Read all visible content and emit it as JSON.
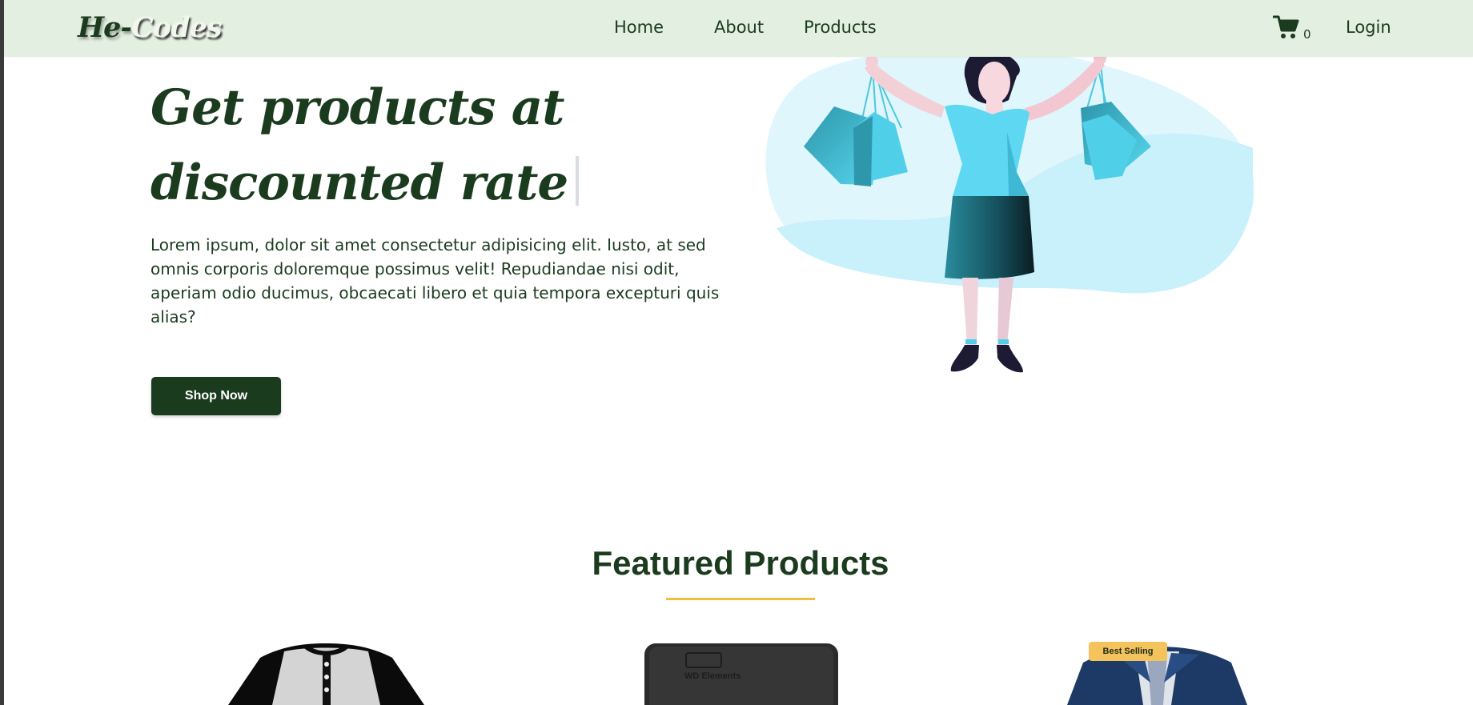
{
  "nav": {
    "logo_part1": "He-",
    "logo_part2": "Codes",
    "links": [
      "Home",
      "About",
      "Products"
    ],
    "cart_count": "0",
    "login": "Login"
  },
  "hero": {
    "title": "Get products at discounted rate",
    "text": "Lorem ipsum, dolor sit amet consectetur adipisicing elit. Iusto, at sed omnis corporis doloremque possimus velit! Repudiandae nisi odit, aperiam odio ducimus, obcaecati libero et quia tempora excepturi quis alias?",
    "button": "Shop Now"
  },
  "featured": {
    "title": "Featured Products",
    "products": [
      {
        "name": "henley-shirt"
      },
      {
        "name": "wd-elements-drive",
        "printed_label": "WD Elements"
      },
      {
        "name": "denim-jacket",
        "badge": "Best Selling"
      }
    ]
  },
  "colors": {
    "brand": "#1b3b1e",
    "navbar_bg": "#e3efe0",
    "accent": "#f0bd43",
    "illustration_blob": "#cdf3fb"
  },
  "icons": [
    "cart-icon"
  ]
}
